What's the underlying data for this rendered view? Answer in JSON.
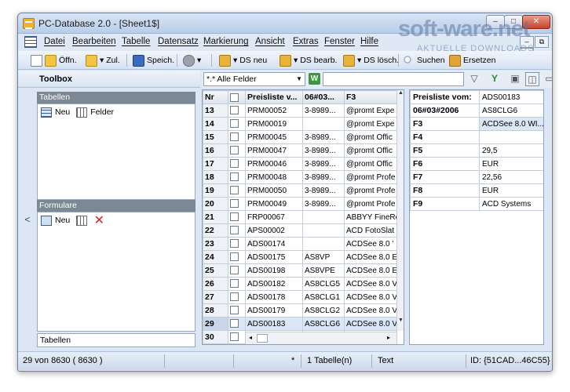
{
  "window": {
    "title": "PC-Database 2.0 - [Sheet1$]",
    "min_glyph": "–",
    "max_glyph": "□",
    "close_glyph": "✕"
  },
  "watermark": {
    "main": "soft-ware.net",
    "sub": "AKTUELLE DOWNLOADS"
  },
  "menu": {
    "items": [
      "Datei",
      "Bearbeiten",
      "Tabelle",
      "Datensatz",
      "Markierung",
      "Ansicht",
      "Extras",
      "Fenster",
      "Hilfe"
    ],
    "mdi_buttons": [
      "–",
      "⧉",
      "✕"
    ]
  },
  "toolbar": {
    "open": "Öffn.",
    "add": "▾ Zul.",
    "save": "Speich.",
    "tools": "▾",
    "ds_new": "▾ DS neu",
    "ds_edit": "▾ DS bearb.",
    "ds_delete": "▾ DS lösch.",
    "search": "Suchen",
    "replace": "Ersetzen"
  },
  "toolbox": {
    "header": "Toolbox",
    "collapse": "<",
    "tables_title": "Tabellen",
    "tables_new": "Neu",
    "tables_fields": "Felder",
    "forms_title": "Formulare",
    "forms_new": "Neu",
    "footer": "Tabellen"
  },
  "filter": {
    "field_select": "*.* Alle Felder",
    "go": "W",
    "funnel": "▽",
    "filter_set": "Y",
    "view1": "▣",
    "view2": "◫",
    "view3": "▭"
  },
  "grid": {
    "columns": [
      "Nr",
      "",
      "Preisliste v...",
      "06#03...",
      "F3"
    ],
    "rows": [
      {
        "nr": "13",
        "c1": "PRM00052",
        "c2": "3-8989...",
        "c3": "@promt Expe"
      },
      {
        "nr": "14",
        "c1": "PRM00019",
        "c2": "",
        "c3": "@promt Expe"
      },
      {
        "nr": "15",
        "c1": "PRM00045",
        "c2": "3-8989...",
        "c3": "@promt Offic"
      },
      {
        "nr": "16",
        "c1": "PRM00047",
        "c2": "3-8989...",
        "c3": "@promt Offic"
      },
      {
        "nr": "17",
        "c1": "PRM00046",
        "c2": "3-8989...",
        "c3": "@promt Offic"
      },
      {
        "nr": "18",
        "c1": "PRM00048",
        "c2": "3-8989...",
        "c3": "@promt Profe"
      },
      {
        "nr": "19",
        "c1": "PRM00050",
        "c2": "3-8989...",
        "c3": "@promt Profe"
      },
      {
        "nr": "20",
        "c1": "PRM00049",
        "c2": "3-8989...",
        "c3": "@promt Profe"
      },
      {
        "nr": "21",
        "c1": "FRP00067",
        "c2": "",
        "c3": "ABBYY FineRe"
      },
      {
        "nr": "22",
        "c1": "APS00002",
        "c2": "",
        "c3": "ACD FotoSlat"
      },
      {
        "nr": "23",
        "c1": "ADS00174",
        "c2": "",
        "c3": "ACDSee 8.0 '"
      },
      {
        "nr": "24",
        "c1": "ADS00175",
        "c2": "AS8VP",
        "c3": "ACDSee 8.0 E"
      },
      {
        "nr": "25",
        "c1": "ADS00198",
        "c2": "AS8VPE",
        "c3": "ACDSee 8.0 E"
      },
      {
        "nr": "26",
        "c1": "ADS00182",
        "c2": "AS8CLG5",
        "c3": "ACDSee 8.0 V"
      },
      {
        "nr": "27",
        "c1": "ADS00178",
        "c2": "AS8CLG1",
        "c3": "ACDSee 8.0 V"
      },
      {
        "nr": "28",
        "c1": "ADS00179",
        "c2": "AS8CLG2",
        "c3": "ACDSee 8.0 V"
      },
      {
        "nr": "29",
        "c1": "ADS00183",
        "c2": "AS8CLG6",
        "c3": "ACDSee 8.0 V"
      },
      {
        "nr": "30",
        "c1": "",
        "c2": "",
        "c3": ""
      }
    ],
    "selected_row": 16,
    "scroll_up": "▲",
    "scroll_down": "▼",
    "scroll_left": "◂",
    "scroll_right": "▸"
  },
  "detail": {
    "rows": [
      {
        "label": "Preisliste vom:",
        "value": "ADS00183"
      },
      {
        "label": "06#03#2006",
        "value": "AS8CLG6"
      },
      {
        "label": "F3",
        "value": "ACDSee 8.0 WI..."
      },
      {
        "label": "F4",
        "value": ""
      },
      {
        "label": "F5",
        "value": "29,5"
      },
      {
        "label": "F6",
        "value": "EUR"
      },
      {
        "label": "F7",
        "value": "22,56"
      },
      {
        "label": "F8",
        "value": "EUR"
      },
      {
        "label": "F9",
        "value": "ACD Systems"
      }
    ]
  },
  "status": {
    "records": "29 von 8630 ( 8630 )",
    "star": "*",
    "tables": "1 Tabelle(n)",
    "mode": "Text",
    "id": "ID: {51CAD...46C55}"
  },
  "colors": {
    "window_bg": "#dce6f4",
    "panel_title": "#7c8894",
    "selection": "#dbe6f6",
    "close_button": "#c8432c"
  }
}
